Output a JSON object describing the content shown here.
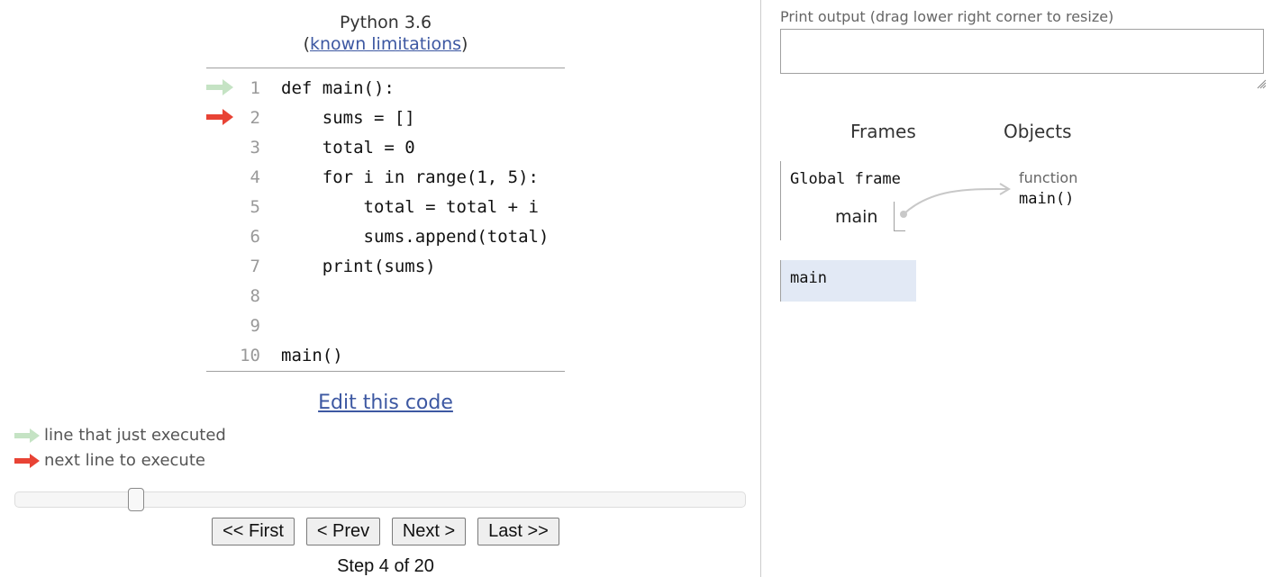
{
  "header": {
    "language": "Python 3.6",
    "paren_open": "(",
    "limitations_link": "known limitations",
    "paren_close": ")"
  },
  "code": {
    "lines": [
      {
        "number": "1",
        "text": "def main():",
        "arrow": "executed"
      },
      {
        "number": "2",
        "text": "    sums = []",
        "arrow": "next"
      },
      {
        "number": "3",
        "text": "    total = 0",
        "arrow": ""
      },
      {
        "number": "4",
        "text": "    for i in range(1, 5):",
        "arrow": ""
      },
      {
        "number": "5",
        "text": "        total = total + i",
        "arrow": ""
      },
      {
        "number": "6",
        "text": "        sums.append(total)",
        "arrow": ""
      },
      {
        "number": "7",
        "text": "    print(sums)",
        "arrow": ""
      },
      {
        "number": "8",
        "text": "",
        "arrow": ""
      },
      {
        "number": "9",
        "text": "",
        "arrow": ""
      },
      {
        "number": "10",
        "text": "main()",
        "arrow": ""
      }
    ],
    "edit_link": "Edit this code"
  },
  "legend": {
    "executed_label": "line that just executed",
    "next_label": "next line to execute"
  },
  "navigation": {
    "first_label": "<< First",
    "prev_label": "< Prev",
    "next_label": "Next >",
    "last_label": "Last >>",
    "step_text": "Step 4 of 20",
    "current_step": 4,
    "total_steps": 20
  },
  "output": {
    "label": "Print output (drag lower right corner to resize)",
    "content": ""
  },
  "visualization": {
    "frames_header": "Frames",
    "objects_header": "Objects",
    "global_frame": {
      "title": "Global frame",
      "variable": "main"
    },
    "object": {
      "type": "function",
      "value": "main()"
    },
    "stack_frame": "main"
  },
  "colors": {
    "executed_arrow": "#c5e3c4",
    "next_arrow": "#e84335",
    "link": "#3d58a2",
    "stack_frame_bg": "#e2e9f5"
  }
}
